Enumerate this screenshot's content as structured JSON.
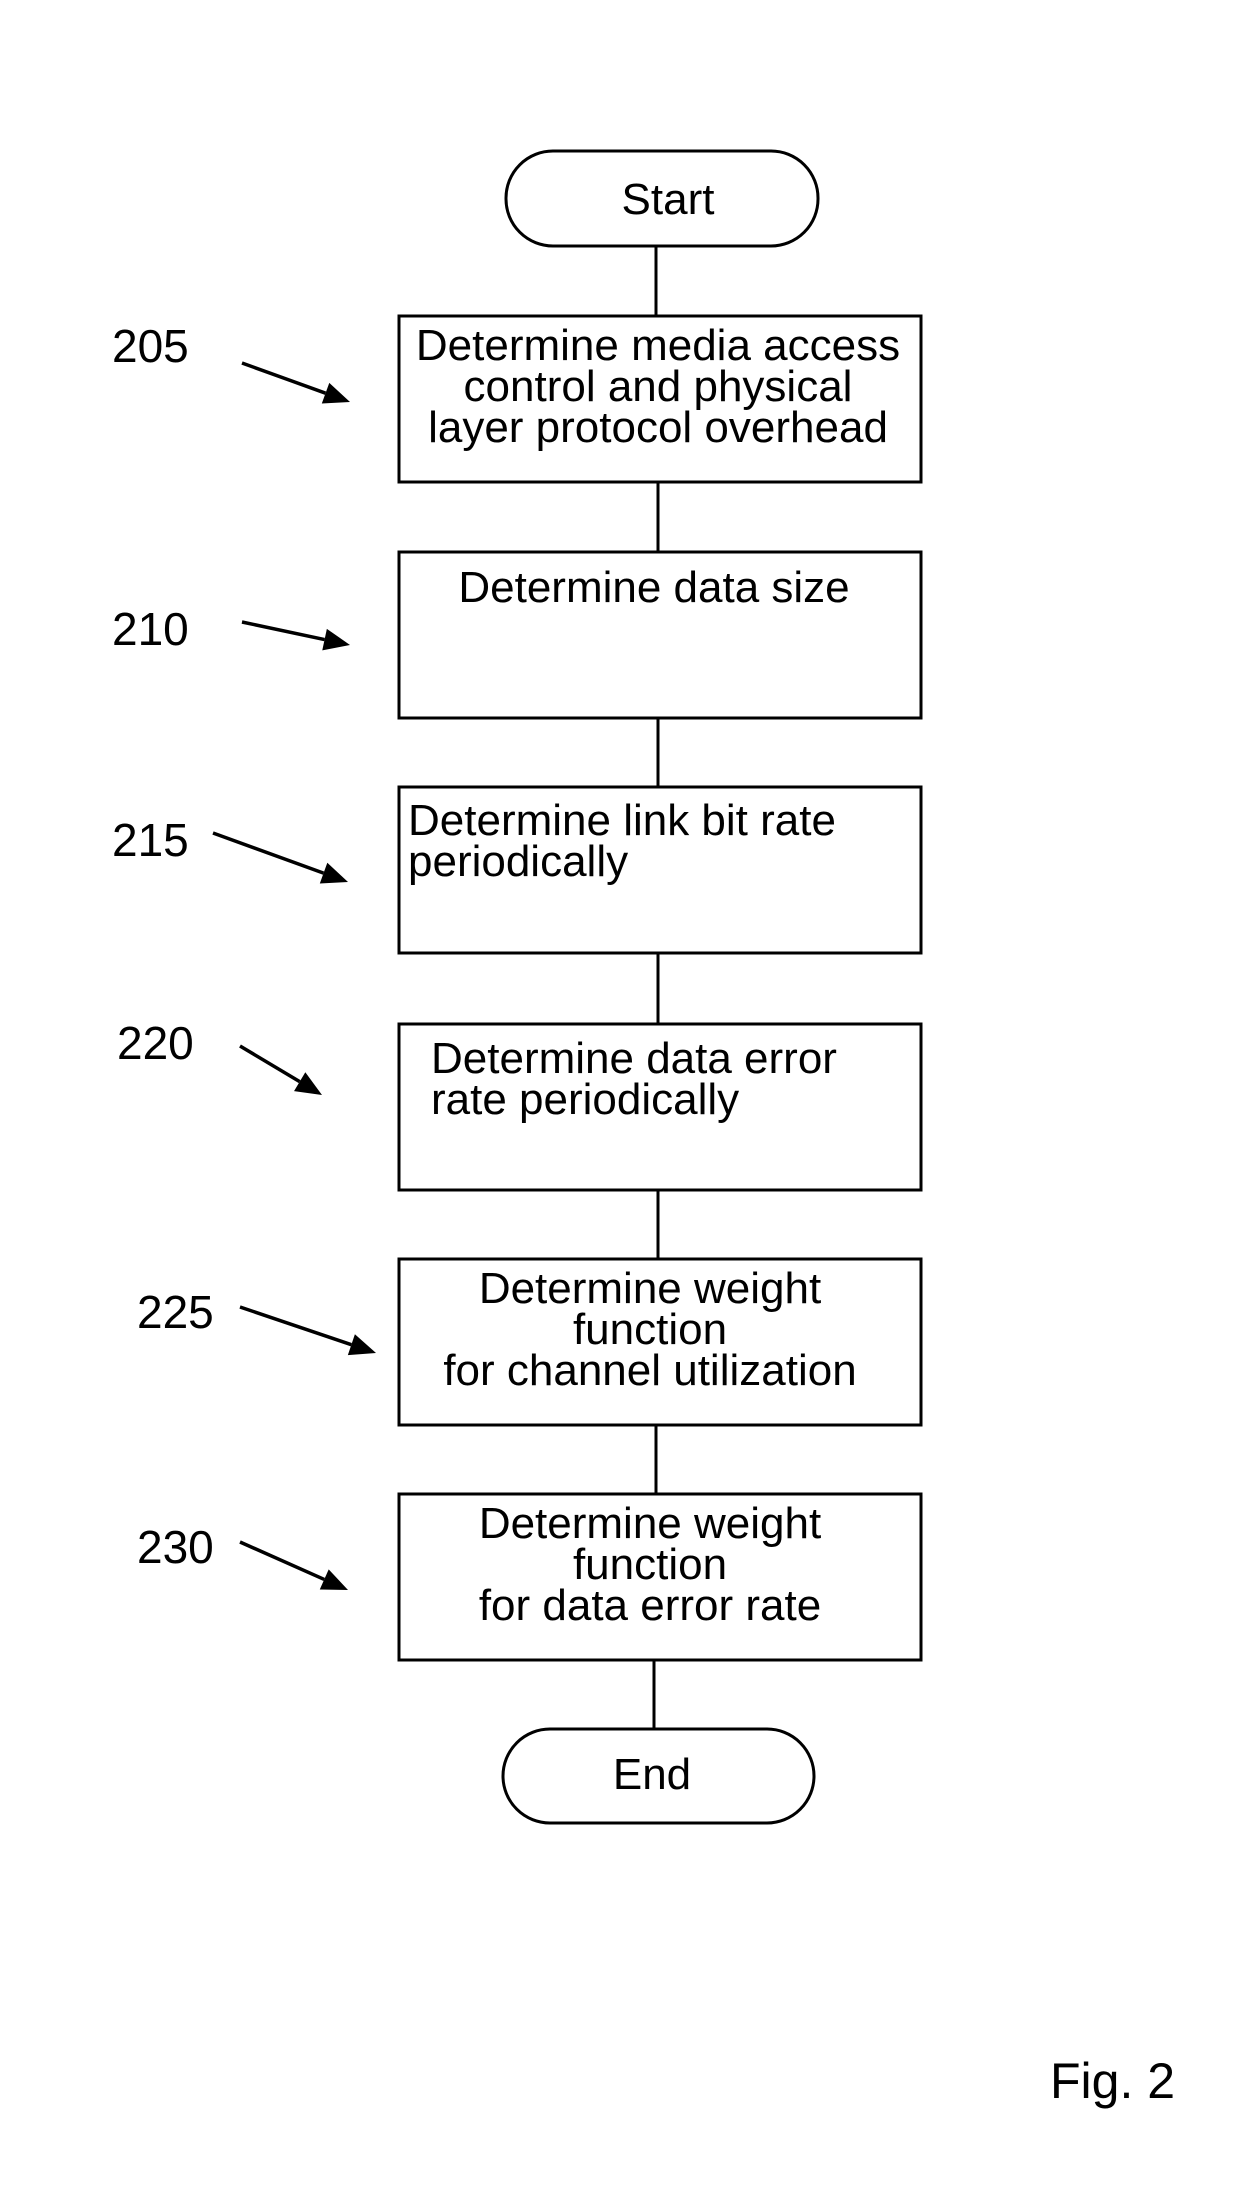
{
  "figure": {
    "label": "Fig. 2",
    "start": {
      "text": "Start"
    },
    "end": {
      "text": "End"
    },
    "steps": [
      {
        "ref": "205",
        "lines": [
          "Determine media access",
          "control and physical",
          "layer protocol overhead"
        ],
        "align": "center"
      },
      {
        "ref": "210",
        "lines": [
          "Determine data size"
        ],
        "align": "center-top"
      },
      {
        "ref": "215",
        "lines": [
          "Determine link bit rate",
          "periodically"
        ],
        "align": "left"
      },
      {
        "ref": "220",
        "lines": [
          "Determine data error",
          "rate periodically"
        ],
        "align": "left-indent"
      },
      {
        "ref": "225",
        "lines": [
          "Determine weight",
          "function",
          "for channel utilization"
        ],
        "align": "center"
      },
      {
        "ref": "230",
        "lines": [
          "Determine weight",
          "function",
          "for data error rate"
        ],
        "align": "center"
      }
    ]
  }
}
